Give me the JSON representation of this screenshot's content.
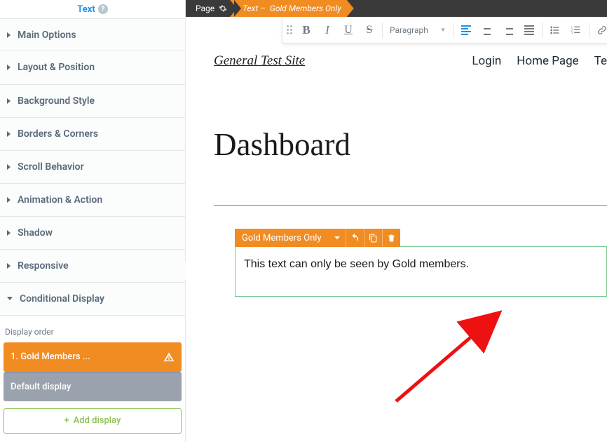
{
  "sidebar": {
    "title": "Text",
    "sections": {
      "main_options": "Main Options",
      "layout_position": "Layout & Position",
      "background_style": "Background Style",
      "borders_corners": "Borders & Corners",
      "scroll_behavior": "Scroll Behavior",
      "animation_action": "Animation & Action",
      "shadow": "Shadow",
      "responsive": "Responsive",
      "conditional_display": "Conditional Display"
    },
    "conditional": {
      "order_label": "Display order",
      "items": [
        {
          "label": "1.  Gold Members ..."
        },
        {
          "label": "Default display"
        }
      ],
      "add_label": "Add display"
    }
  },
  "breadcrumb": {
    "page": "Page",
    "selected_prefix": "Text – ",
    "selected_name": "Gold Members Only"
  },
  "toolbar": {
    "paragraph": "Paragraph"
  },
  "site": {
    "title": "General Test Site",
    "nav": {
      "login": "Login",
      "home": "Home Page",
      "te": "Te"
    }
  },
  "page": {
    "title": "Dashboard"
  },
  "text_element": {
    "header_label": "Gold Members Only",
    "content": "This text can only be seen by Gold members."
  },
  "colors": {
    "accent_blue": "#1a94e6",
    "accent_orange": "#f18c22",
    "accent_green": "#8cc152",
    "sel_border_green": "#7cc68d"
  }
}
